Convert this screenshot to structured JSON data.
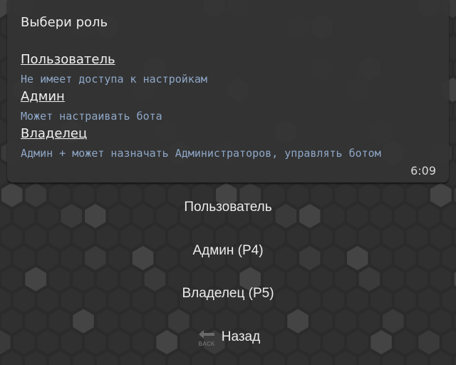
{
  "message": {
    "title": "Выбери роль",
    "roles": [
      {
        "label": "Пользователь",
        "description": "Не имеет доступа к настройкам"
      },
      {
        "label": "Админ",
        "description": "Может настраивать бота"
      },
      {
        "label": "Владелец",
        "description": "Админ + может назначать Администраторов, управлять ботом"
      }
    ],
    "time": "6:09"
  },
  "keyboard": {
    "buttons": [
      {
        "label": "Пользователь"
      },
      {
        "label": "Админ (P4)"
      },
      {
        "label": "Владелец (P5)"
      }
    ],
    "back": {
      "label": "Назад",
      "icon": "back-arrow-icon",
      "icon_text": "BACK"
    }
  },
  "colors": {
    "background": "#2b2b2b",
    "bubble": "#343434",
    "text": "#ececec",
    "description": "#8fa8c8"
  }
}
